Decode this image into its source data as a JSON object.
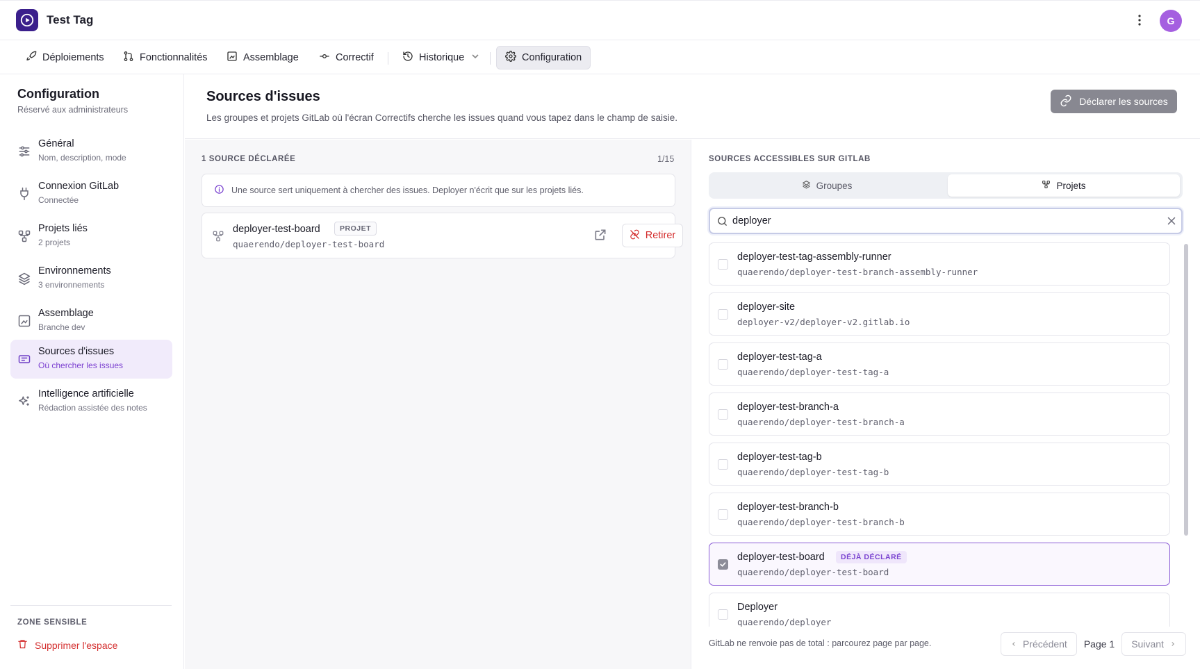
{
  "app": {
    "title": "Test Tag",
    "avatar_initial": "G",
    "brand_color": "#3b1f8c",
    "accent_color": "#7a43d0",
    "danger_color": "#d42f2f"
  },
  "nav": {
    "items": [
      {
        "label": "Déploiements",
        "icon": "rocket-icon"
      },
      {
        "label": "Fonctionnalités",
        "icon": "git-pull-request-icon"
      },
      {
        "label": "Assemblage",
        "icon": "build-frame-icon"
      },
      {
        "label": "Correctif",
        "icon": "git-commit-icon"
      },
      {
        "label": "Historique",
        "icon": "history-icon"
      },
      {
        "label": "Configuration",
        "icon": "gear-icon",
        "active": true
      }
    ]
  },
  "sidebar": {
    "title": "Configuration",
    "subtitle": "Réservé aux administrateurs",
    "items": [
      {
        "label": "Général",
        "desc": "Nom, description, mode",
        "icon": "sliders-icon"
      },
      {
        "label": "Connexion GitLab",
        "desc": "Connectée",
        "icon": "plug-icon"
      },
      {
        "label": "Projets liés",
        "desc": "2 projets",
        "icon": "project-nodes-icon"
      },
      {
        "label": "Environnements",
        "desc": "3 environnements",
        "icon": "layers-icon"
      },
      {
        "label": "Assemblage",
        "desc": "Branche dev",
        "icon": "build-frame-icon"
      },
      {
        "label": "Sources d'issues",
        "desc": "Où chercher les issues",
        "icon": "ticket-icon",
        "active": true
      },
      {
        "label": "Intelligence artificielle",
        "desc": "Rédaction assistée des notes",
        "icon": "sparkles-icon"
      }
    ],
    "zone_label": "ZONE SENSIBLE",
    "delete_label": "Supprimer l'espace"
  },
  "main": {
    "title": "Sources d'issues",
    "description": "Les groupes et projets GitLab où l'écran Correctifs cherche les issues quand vous tapez dans le champ de saisie.",
    "declare_button": "Déclarer les sources"
  },
  "declared": {
    "label": "1 SOURCE DÉCLARÉE",
    "count": "1/15",
    "info": "Une source sert uniquement à chercher des issues. Deployer n'écrit que sur les projets liés.",
    "sources": [
      {
        "name": "deployer-test-board",
        "badge": "PROJET",
        "path": "quaerendo/deployer-test-board",
        "remove_label": "Retirer"
      }
    ]
  },
  "accessible": {
    "label": "SOURCES ACCESSIBLES SUR GITLAB",
    "tabs": [
      {
        "label": "Groupes",
        "icon": "layers-icon"
      },
      {
        "label": "Projets",
        "icon": "project-nodes-icon",
        "active": true
      }
    ],
    "search_value": "deployer",
    "results": [
      {
        "name": "deployer-test-tag-assembly-runner",
        "path": "quaerendo/deployer-test-branch-assembly-runner",
        "checked": false
      },
      {
        "name": "deployer-site",
        "path": "deployer-v2/deployer-v2.gitlab.io",
        "checked": false
      },
      {
        "name": "deployer-test-tag-a",
        "path": "quaerendo/deployer-test-tag-a",
        "checked": false
      },
      {
        "name": "deployer-test-branch-a",
        "path": "quaerendo/deployer-test-branch-a",
        "checked": false
      },
      {
        "name": "deployer-test-tag-b",
        "path": "quaerendo/deployer-test-tag-b",
        "checked": false
      },
      {
        "name": "deployer-test-branch-b",
        "path": "quaerendo/deployer-test-branch-b",
        "checked": false
      },
      {
        "name": "deployer-test-board",
        "path": "quaerendo/deployer-test-board",
        "checked": true,
        "badge": "DÉJÀ DÉCLARÉ"
      },
      {
        "name": "Deployer",
        "path": "quaerendo/deployer",
        "checked": false
      }
    ],
    "footer_note": "GitLab ne renvoie pas de total : parcourez page par page.",
    "pager": {
      "prev": "Précédent",
      "current": "Page 1",
      "next": "Suivant"
    }
  }
}
